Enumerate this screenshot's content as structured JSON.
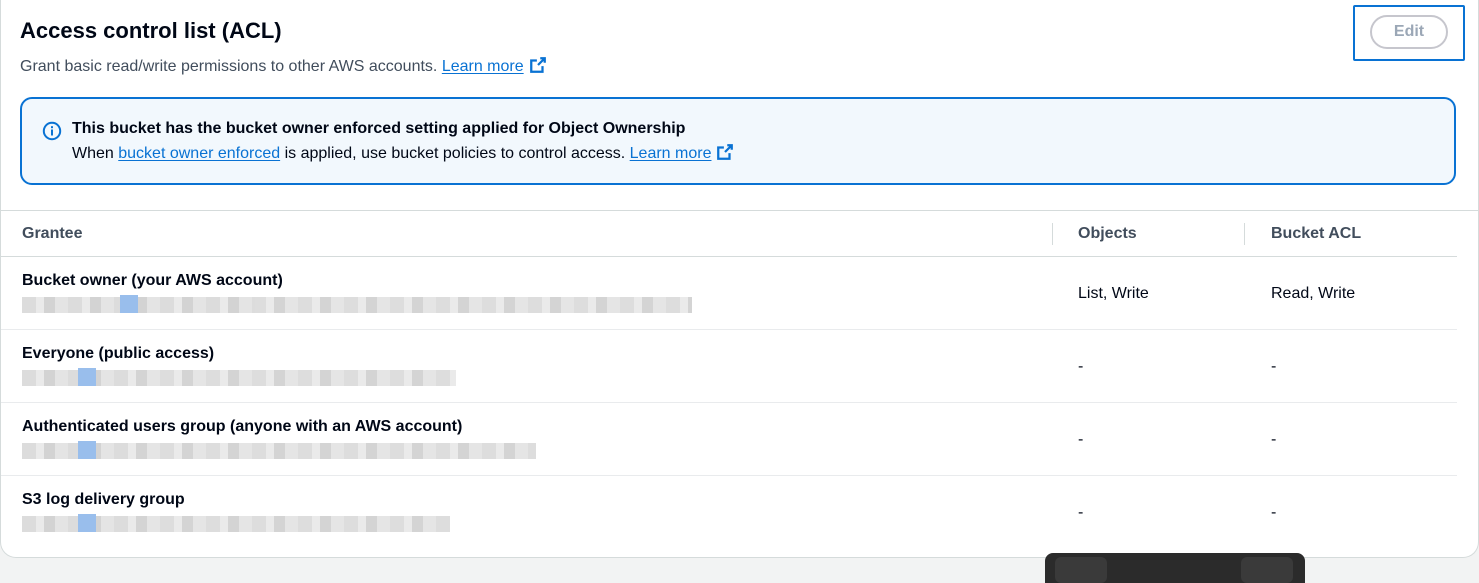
{
  "section": {
    "title": "Access control list (ACL)",
    "description": "Grant basic read/write permissions to other AWS accounts.",
    "learn_more": "Learn more",
    "edit_label": "Edit"
  },
  "alert": {
    "title": "This bucket has the bucket owner enforced setting applied for Object Ownership",
    "body_prefix": "When",
    "body_link": "bucket owner enforced",
    "body_suffix": "is applied, use bucket policies to control access.",
    "learn_more": "Learn more",
    "color": "#0972d3"
  },
  "table": {
    "columns": [
      "Grantee",
      "Objects",
      "Bucket ACL"
    ],
    "rows": [
      {
        "grantee": "Bucket owner (your AWS account)",
        "objects": "List, Write",
        "bucket_acl": "Read, Write"
      },
      {
        "grantee": "Everyone (public access)",
        "objects": "-",
        "bucket_acl": "-"
      },
      {
        "grantee": "Authenticated users group (anyone with an AWS account)",
        "objects": "-",
        "bucket_acl": "-"
      },
      {
        "grantee": "S3 log delivery group",
        "objects": "-",
        "bucket_acl": "-"
      }
    ]
  },
  "icons": {
    "external": "external-link-icon",
    "info": "info-icon"
  }
}
